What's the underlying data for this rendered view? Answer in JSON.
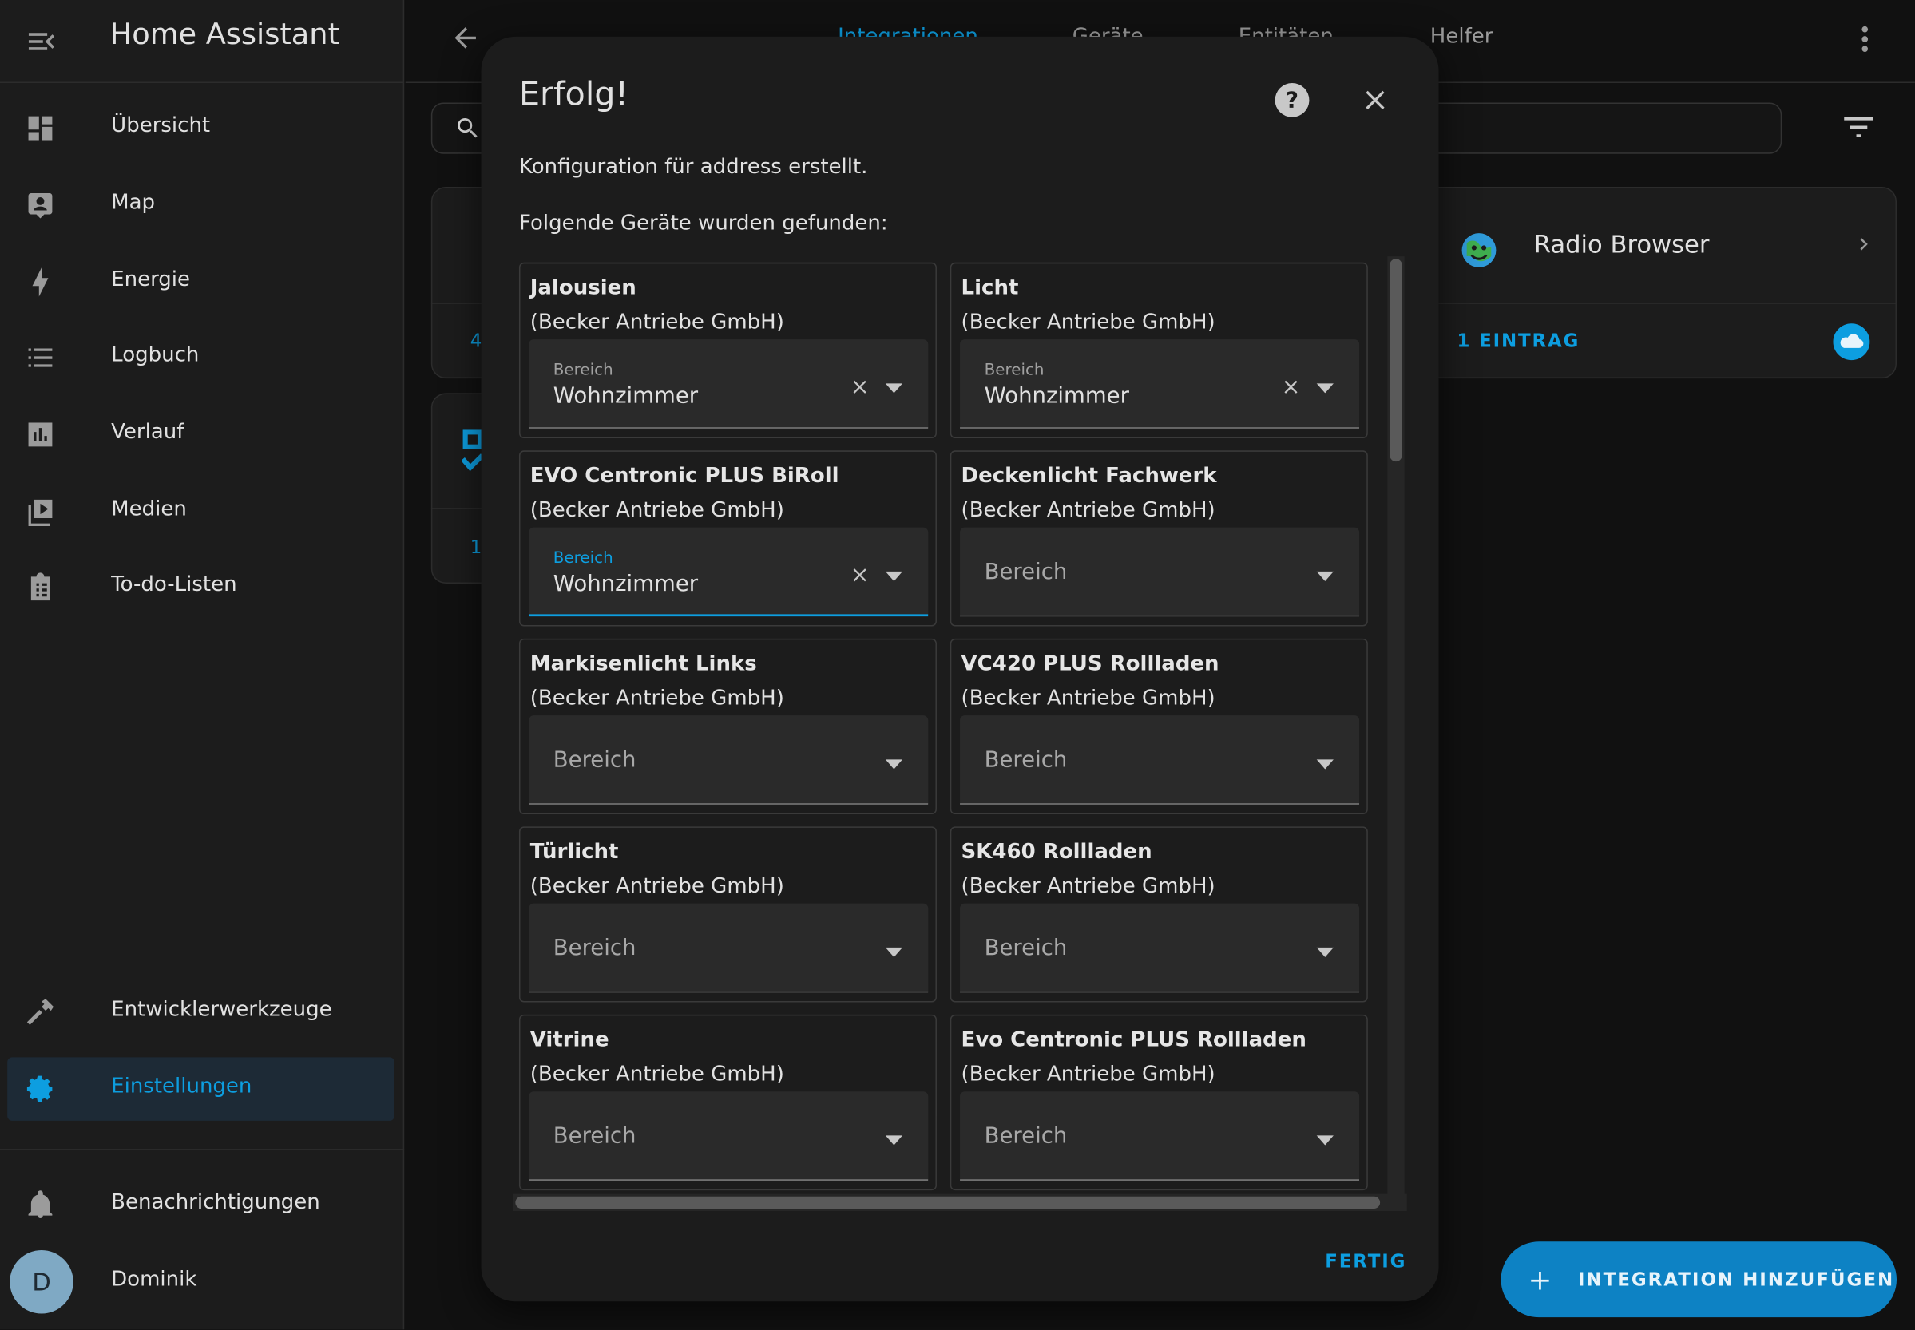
{
  "app": {
    "title": "Home Assistant"
  },
  "sidebar": {
    "items": [
      {
        "label": "Übersicht",
        "icon": "dashboard-icon"
      },
      {
        "label": "Map",
        "icon": "map-account-icon"
      },
      {
        "label": "Energie",
        "icon": "lightning-bolt-icon"
      },
      {
        "label": "Logbuch",
        "icon": "format-list-bulleted-icon"
      },
      {
        "label": "Verlauf",
        "icon": "chart-box-icon"
      },
      {
        "label": "Medien",
        "icon": "play-box-multiple-icon"
      },
      {
        "label": "To-do-Listen",
        "icon": "clipboard-list-icon"
      }
    ],
    "bottom_items": [
      {
        "label": "Entwicklerwerkzeuge",
        "icon": "hammer-icon"
      },
      {
        "label": "Einstellungen",
        "icon": "cog-icon",
        "active": true
      }
    ],
    "notifications": {
      "label": "Benachrichtigungen"
    },
    "user": {
      "initial": "D",
      "name": "Dominik"
    }
  },
  "topbar": {
    "tabs": [
      {
        "label": "Integrationen",
        "active": true
      },
      {
        "label": "Geräte"
      },
      {
        "label": "Entitäten"
      },
      {
        "label": "Helfer"
      }
    ]
  },
  "background": {
    "card": {
      "name": "Radio Browser",
      "entries": "1 EINTRAG"
    },
    "partial_counts": [
      "4",
      "1"
    ],
    "fab_label": "INTEGRATION HINZUFÜGEN"
  },
  "dialog": {
    "title": "Erfolg!",
    "message": "Konfiguration für address erstellt.",
    "devices_heading": "Folgende Geräte wurden gefunden:",
    "area_label": "Bereich",
    "devices": [
      {
        "name": "Jalousien",
        "manufacturer": "(Becker Antriebe GmbH)",
        "area": "Wohnzimmer"
      },
      {
        "name": "Licht",
        "manufacturer": "(Becker Antriebe GmbH)",
        "area": "Wohnzimmer"
      },
      {
        "name": "EVO Centronic PLUS BiRoll",
        "manufacturer": "(Becker Antriebe GmbH)",
        "area": "Wohnzimmer",
        "focused": true
      },
      {
        "name": "Deckenlicht Fachwerk",
        "manufacturer": "(Becker Antriebe GmbH)",
        "area": ""
      },
      {
        "name": "Markisenlicht Links",
        "manufacturer": "(Becker Antriebe GmbH)",
        "area": ""
      },
      {
        "name": "VC420 PLUS Rollladen",
        "manufacturer": "(Becker Antriebe GmbH)",
        "area": ""
      },
      {
        "name": "Türlicht",
        "manufacturer": "(Becker Antriebe GmbH)",
        "area": ""
      },
      {
        "name": "SK460 Rollladen",
        "manufacturer": "(Becker Antriebe GmbH)",
        "area": ""
      },
      {
        "name": "Vitrine",
        "manufacturer": "(Becker Antriebe GmbH)",
        "area": ""
      },
      {
        "name": "Evo Centronic PLUS Rollladen",
        "manufacturer": "(Becker Antriebe GmbH)",
        "area": ""
      }
    ],
    "done_label": "FERTIG"
  },
  "colors": {
    "accent": "#0d9ee0",
    "background": "#111111",
    "surface": "#1c1c1c"
  }
}
